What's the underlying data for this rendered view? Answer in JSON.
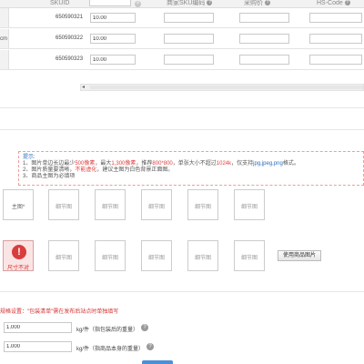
{
  "sku_table": {
    "headers": {
      "skuid": "SKUID",
      "merchant_code": "商家SKU编码",
      "market_price": "采购价",
      "hs_code": "HS-Code"
    },
    "rows": [
      {
        "left": "",
        "skuid": "650590321",
        "value": "10.00"
      },
      {
        "left": "cm",
        "skuid": "650590322",
        "value": "10.00"
      },
      {
        "left": "",
        "skuid": "650590323",
        "value": "10.00"
      }
    ],
    "clear_symbol": "×",
    "help_symbol": "?"
  },
  "scrollbar": {
    "arrow": "◂"
  },
  "tips": {
    "title": "提示:",
    "line1_a": "1、图片单边长边最少",
    "line1_b": "500像素",
    "line1_c": "，最大",
    "line1_d": "1,300像素",
    "line1_e": "，推荐",
    "line1_f": "800*800",
    "line1_g": "，单张大小不超过",
    "line1_h": "1024k",
    "line1_i": "，仅支持",
    "line1_j": "jpg,jpeg,png",
    "line1_k": "格式。",
    "line2_a": "2、图片质量要清晰，",
    "line2_b": "不能虚化",
    "line2_c": "，建议主图为白色背景正面图。",
    "line3": "3、商品主图为必填项"
  },
  "images": {
    "row1": [
      "主图*",
      "细节图",
      "细节图",
      "细节图",
      "细节图",
      "细节图"
    ],
    "row2": [
      "细节图",
      "细节图",
      "细节图",
      "细节图",
      "细节图"
    ],
    "error_icon": "!",
    "error_text": "尺寸不对",
    "use_product_images": "使用商品图片"
  },
  "package": {
    "warning": "规格设置：\"包装清单\"需在发布后站点时单独填写",
    "weight_value": "1.000",
    "weight_unit": "kg/件（指包装后的重量）",
    "net_weight_value": "1.000",
    "net_weight_unit": "kg/件（指商品本身的重量）",
    "help_symbol": "?"
  },
  "colors": {
    "accent_blue": "#2a6ebb",
    "error_red": "#d43030",
    "tips_border": "#e8a0a0"
  }
}
